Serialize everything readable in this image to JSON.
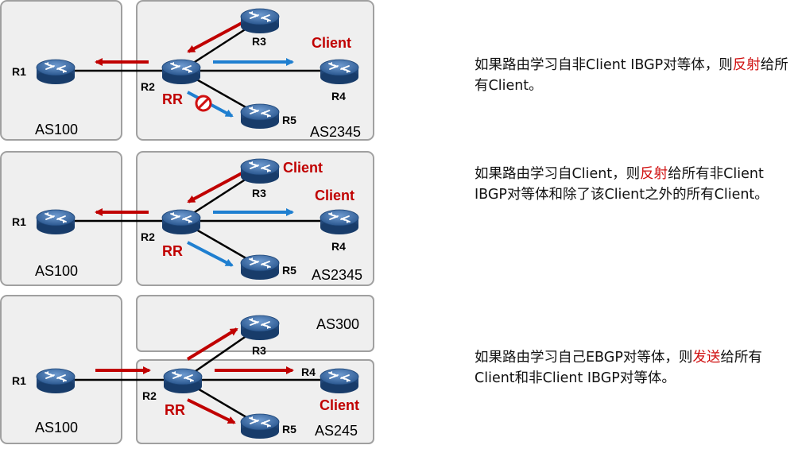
{
  "panels": [
    {
      "as_left": "AS100",
      "as_right": "AS2345",
      "routers": {
        "r1": "R1",
        "r2": "R2",
        "r3": "R3",
        "r4": "R4",
        "r5": "R5"
      },
      "rr_label": "RR",
      "client_labels": [
        "Client"
      ],
      "description": {
        "part1": "如果路由学习自非Client  IBGP对等体，则",
        "highlight": "反射",
        "part2": "给所有Client。"
      }
    },
    {
      "as_left": "AS100",
      "as_right": "AS2345",
      "routers": {
        "r1": "R1",
        "r2": "R2",
        "r3": "R3",
        "r4": "R4",
        "r5": "R5"
      },
      "rr_label": "RR",
      "client_labels": [
        "Client",
        "Client"
      ],
      "description": {
        "part1": "如果路由学习自Client，则",
        "highlight": "反射",
        "part2": "给所有非Client  IBGP对等体和除了该Client之外的所有Client。"
      }
    },
    {
      "as_left": "AS100",
      "as_top": "AS300",
      "as_right": "AS245",
      "routers": {
        "r1": "R1",
        "r2": "R2",
        "r3": "R3",
        "r4": "R4",
        "r5": "R5"
      },
      "rr_label": "RR",
      "client_labels": [
        "Client"
      ],
      "description": {
        "part1": "如果路由学习自己EBGP对等体，则",
        "highlight": "发送",
        "part2": "给所有Client和非Client  IBGP对等体。"
      }
    }
  ],
  "colors": {
    "client_red": "#c00000",
    "arrow_red": "#c00000",
    "arrow_blue": "#1f7fd0",
    "panel_fill": "#efefef",
    "panel_border": "#a0a0a0",
    "router_blue": "#3f6fa8"
  },
  "icons": {
    "router": "router-icon",
    "blocked": "no-entry-icon"
  }
}
